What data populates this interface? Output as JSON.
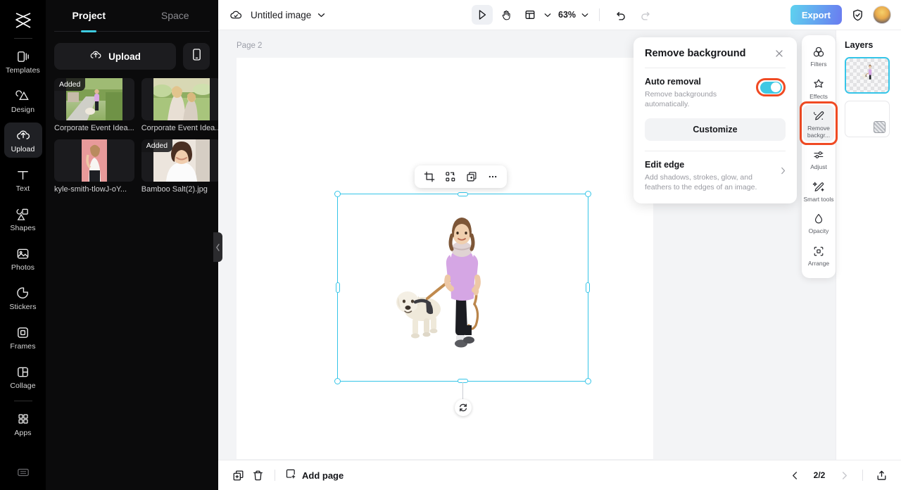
{
  "app": {
    "logo": "capcut-logo",
    "rail_items": [
      {
        "label": "Templates",
        "icon": "templates-icon",
        "active": false
      },
      {
        "label": "Design",
        "icon": "design-icon",
        "active": false
      },
      {
        "label": "Upload",
        "icon": "upload-cloud-icon",
        "active": true
      },
      {
        "label": "Text",
        "icon": "text-icon",
        "active": false
      },
      {
        "label": "Shapes",
        "icon": "shapes-icon",
        "active": false
      },
      {
        "label": "Photos",
        "icon": "photos-icon",
        "active": false
      },
      {
        "label": "Stickers",
        "icon": "stickers-icon",
        "active": false
      },
      {
        "label": "Frames",
        "icon": "frames-icon",
        "active": false
      },
      {
        "label": "Collage",
        "icon": "collage-icon",
        "active": false
      },
      {
        "label": "Apps",
        "icon": "apps-grid-icon",
        "active": false
      }
    ]
  },
  "panel": {
    "tabs": [
      {
        "label": "Project",
        "active": true
      },
      {
        "label": "Space",
        "active": false
      }
    ],
    "upload_label": "Upload",
    "device_button": "mobile-device-icon",
    "media": [
      {
        "name": "Corporate Event Idea...",
        "badge": "Added"
      },
      {
        "name": "Corporate Event Idea...",
        "badge": ""
      },
      {
        "name": "kyle-smith-tlowJ-oY...",
        "badge": ""
      },
      {
        "name": "Bamboo Salt(2).jpg",
        "badge": "Added"
      }
    ]
  },
  "topbar": {
    "cloud_icon": "cloud-sync-icon",
    "doc_title": "Untitled image",
    "caret": "chevron-down-icon",
    "tools": [
      {
        "name": "select-cursor-tool",
        "active": true
      },
      {
        "name": "hand-pan-tool",
        "active": false
      },
      {
        "name": "layout-grid-tool",
        "active": false
      }
    ],
    "zoom_level": "63%",
    "undo": "undo-icon",
    "redo": "redo-icon",
    "export_label": "Export",
    "shield_icon": "shield-check-icon",
    "avatar": "user-avatar"
  },
  "canvas": {
    "page_label": "Page 2",
    "object_toolbar": [
      {
        "name": "crop-button",
        "icon": "crop-icon"
      },
      {
        "name": "flip-button",
        "icon": "flip-transform-icon"
      },
      {
        "name": "duplicate-button",
        "icon": "duplicate-icon"
      },
      {
        "name": "more-options-button",
        "icon": "ellipsis-icon"
      }
    ],
    "rotate_handle": "rotate-icon"
  },
  "remove_background": {
    "title": "Remove background",
    "close_icon": "close-icon",
    "auto_removal": {
      "title": "Auto removal",
      "description": "Remove backgrounds automatically.",
      "enabled": true,
      "toggle_color": "#3fc8e4",
      "highlight_color": "#f04a23"
    },
    "customize_label": "Customize",
    "edit_edge": {
      "title": "Edit edge",
      "description": "Add shadows, strokes, glow, and feathers to the edges of an image.",
      "chevron": "chevron-right-icon"
    }
  },
  "toolstrip": {
    "items": [
      {
        "label": "Filters",
        "icon": "filters-icon",
        "active": false,
        "highlighted": false
      },
      {
        "label": "Effects",
        "icon": "effects-star-icon",
        "active": false,
        "highlighted": false
      },
      {
        "label": "Remove backgr...",
        "icon": "remove-background-icon",
        "active": true,
        "highlighted": true
      },
      {
        "label": "Adjust",
        "icon": "adjust-sliders-icon",
        "active": false,
        "highlighted": false
      },
      {
        "label": "Smart tools",
        "icon": "smart-tools-wand-icon",
        "active": false,
        "highlighted": false
      },
      {
        "label": "Opacity",
        "icon": "opacity-drop-icon",
        "active": false,
        "highlighted": false
      },
      {
        "label": "Arrange",
        "icon": "arrange-icon",
        "active": false,
        "highlighted": false
      }
    ]
  },
  "layers": {
    "title": "Layers",
    "items": [
      {
        "name": "image-layer",
        "selected": true
      },
      {
        "name": "background-layer",
        "selected": false
      }
    ]
  },
  "bottombar": {
    "duplicate_page_icon": "duplicate-page-icon",
    "delete_page_icon": "trash-icon",
    "add_page_label": "Add page",
    "add_page_icon": "add-page-icon",
    "prev_icon": "chevron-left-icon",
    "next_icon": "chevron-right-icon",
    "page_count": "2/2",
    "export_page_icon": "upload-tray-icon"
  },
  "colors": {
    "accent_cyan": "#35c5e8",
    "highlight_red": "#f04a23",
    "rail_bg": "#000000",
    "panel_bg": "#0b0b0c",
    "editor_bg": "#f3f4f6"
  }
}
